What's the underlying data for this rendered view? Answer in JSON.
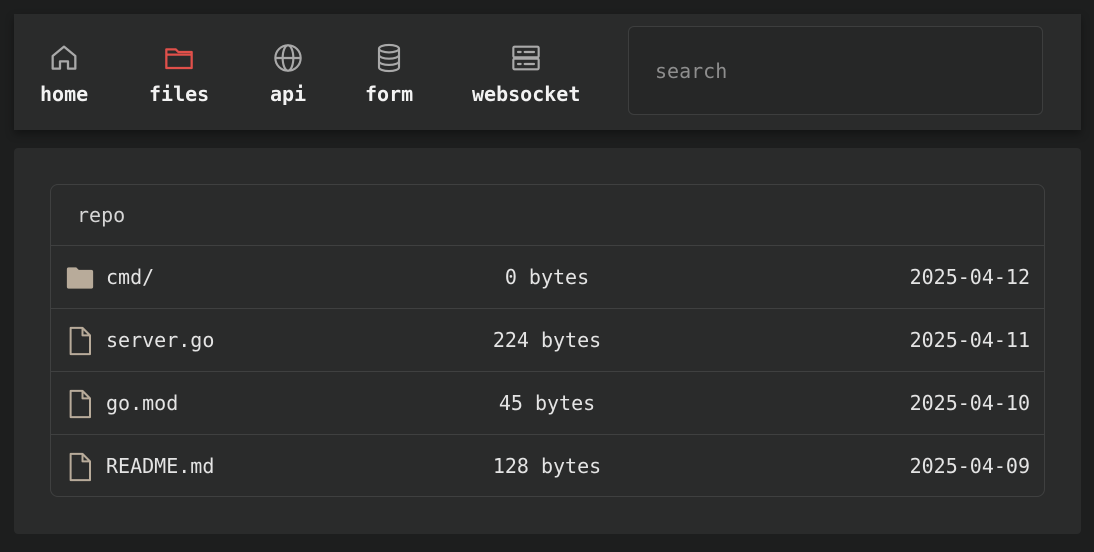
{
  "nav": {
    "items": [
      {
        "label": "home",
        "icon": "home-icon",
        "active": false
      },
      {
        "label": "files",
        "icon": "folder-icon",
        "active": true
      },
      {
        "label": "api",
        "icon": "globe-icon",
        "active": false
      },
      {
        "label": "form",
        "icon": "database-icon",
        "active": false
      },
      {
        "label": "websocket",
        "icon": "server-icon",
        "active": false
      }
    ],
    "active_color": "#e0504a",
    "icon_color": "#a9a9a9"
  },
  "search": {
    "placeholder": "search",
    "value": ""
  },
  "repo": {
    "title": "repo",
    "files": [
      {
        "name": "cmd/",
        "size": "0 bytes",
        "date": "2025-04-12",
        "type": "folder"
      },
      {
        "name": "server.go",
        "size": "224 bytes",
        "date": "2025-04-11",
        "type": "file"
      },
      {
        "name": "go.mod",
        "size": "45 bytes",
        "date": "2025-04-10",
        "type": "file"
      },
      {
        "name": "README.md",
        "size": "128 bytes",
        "date": "2025-04-09",
        "type": "file"
      }
    ],
    "icon_color": "#b8ab9a"
  }
}
